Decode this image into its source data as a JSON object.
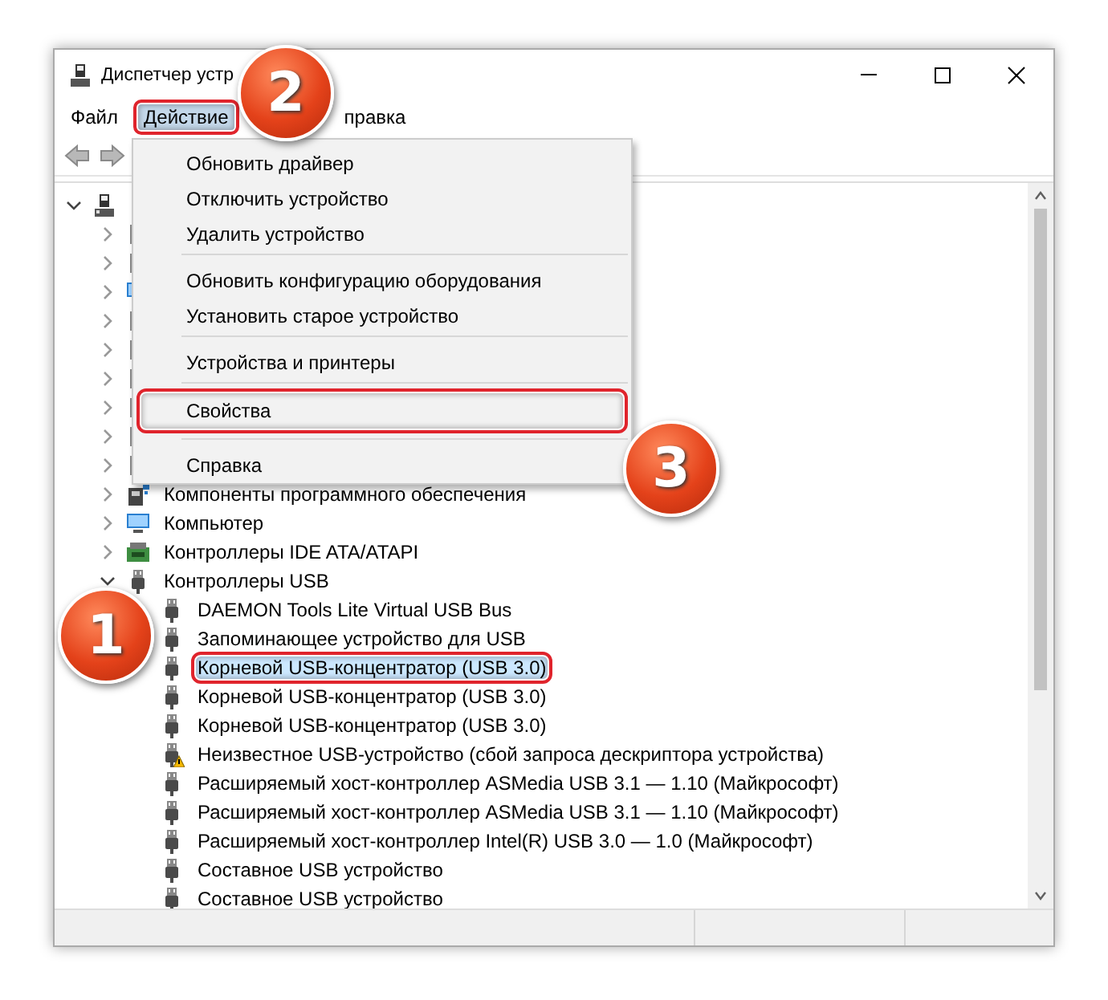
{
  "window": {
    "title": "Диспетчер устр"
  },
  "menu_bar": [
    {
      "label": "Файл",
      "selected": false,
      "annotated": false
    },
    {
      "label": "Действие",
      "selected": true,
      "annotated": true
    },
    {
      "label": "правка",
      "selected": false,
      "annotated": false
    }
  ],
  "menu_popup": [
    {
      "kind": "item",
      "label": "Обновить драйвер",
      "annotated": false
    },
    {
      "kind": "item",
      "label": "Отключить устройство",
      "annotated": false
    },
    {
      "kind": "item",
      "label": "Удалить устройство",
      "annotated": false
    },
    {
      "kind": "separator"
    },
    {
      "kind": "item",
      "label": "Обновить конфигурацию оборудования",
      "annotated": false
    },
    {
      "kind": "item",
      "label": "Установить старое устройство",
      "annotated": false
    },
    {
      "kind": "separator"
    },
    {
      "kind": "item",
      "label": "Устройства и принтеры",
      "annotated": false
    },
    {
      "kind": "separator"
    },
    {
      "kind": "item",
      "label": "Свойства",
      "annotated": true
    },
    {
      "kind": "separator"
    },
    {
      "kind": "item",
      "label": "Справка",
      "annotated": false
    }
  ],
  "tree": {
    "kind": "computer",
    "expanded": true,
    "children": [
      {
        "kind": "generic",
        "expanded": false
      },
      {
        "kind": "generic",
        "expanded": false
      },
      {
        "kind": "monitor",
        "expanded": false
      },
      {
        "kind": "generic",
        "expanded": false
      },
      {
        "kind": "generic",
        "expanded": false
      },
      {
        "kind": "generic",
        "expanded": false
      },
      {
        "kind": "generic",
        "expanded": false
      },
      {
        "kind": "generic",
        "expanded": false
      },
      {
        "kind": "generic",
        "expanded": false
      },
      {
        "kind": "software",
        "label": "Компоненты программного обеспечения",
        "expanded": false
      },
      {
        "kind": "monitor",
        "label": "Компьютер",
        "expanded": false
      },
      {
        "kind": "ide",
        "label": "Контроллеры IDE ATA/ATAPI",
        "expanded": false
      },
      {
        "kind": "usb",
        "label": "Контроллеры USB",
        "expanded": true,
        "children": [
          {
            "kind": "usb",
            "label": "DAEMON Tools Lite Virtual USB Bus",
            "selected": false,
            "warning": false,
            "annotated": false
          },
          {
            "kind": "usb",
            "label": "Запоминающее устройство для USB",
            "selected": false,
            "warning": false,
            "annotated": false
          },
          {
            "kind": "usb",
            "label": "Корневой USB-концентратор (USB 3.0)",
            "selected": true,
            "warning": false,
            "annotated": true
          },
          {
            "kind": "usb",
            "label": "Корневой USB-концентратор (USB 3.0)",
            "selected": false,
            "warning": false,
            "annotated": false
          },
          {
            "kind": "usb",
            "label": "Корневой USB-концентратор (USB 3.0)",
            "selected": false,
            "warning": false,
            "annotated": false
          },
          {
            "kind": "usb",
            "label": "Неизвестное USB-устройство (сбой запроса дескриптора устройства)",
            "selected": false,
            "warning": true,
            "annotated": false
          },
          {
            "kind": "usb",
            "label": "Расширяемый хост-контроллер ASMedia USB 3.1 — 1.10 (Майкрософт)",
            "selected": false,
            "warning": false,
            "annotated": false
          },
          {
            "kind": "usb",
            "label": "Расширяемый хост-контроллер ASMedia USB 3.1 — 1.10 (Майкрософт)",
            "selected": false,
            "warning": false,
            "annotated": false
          },
          {
            "kind": "usb",
            "label": "Расширяемый хост-контроллер Intel(R) USB 3.0 — 1.0 (Майкрософт)",
            "selected": false,
            "warning": false,
            "annotated": false
          },
          {
            "kind": "usb",
            "label": "Составное USB устройство",
            "selected": false,
            "warning": false,
            "annotated": false
          },
          {
            "kind": "usb",
            "label": "Составное USB устройство",
            "selected": false,
            "warning": false,
            "annotated": false
          }
        ]
      }
    ]
  },
  "callouts": [
    {
      "label": "1"
    },
    {
      "label": "2"
    },
    {
      "label": "3"
    }
  ]
}
